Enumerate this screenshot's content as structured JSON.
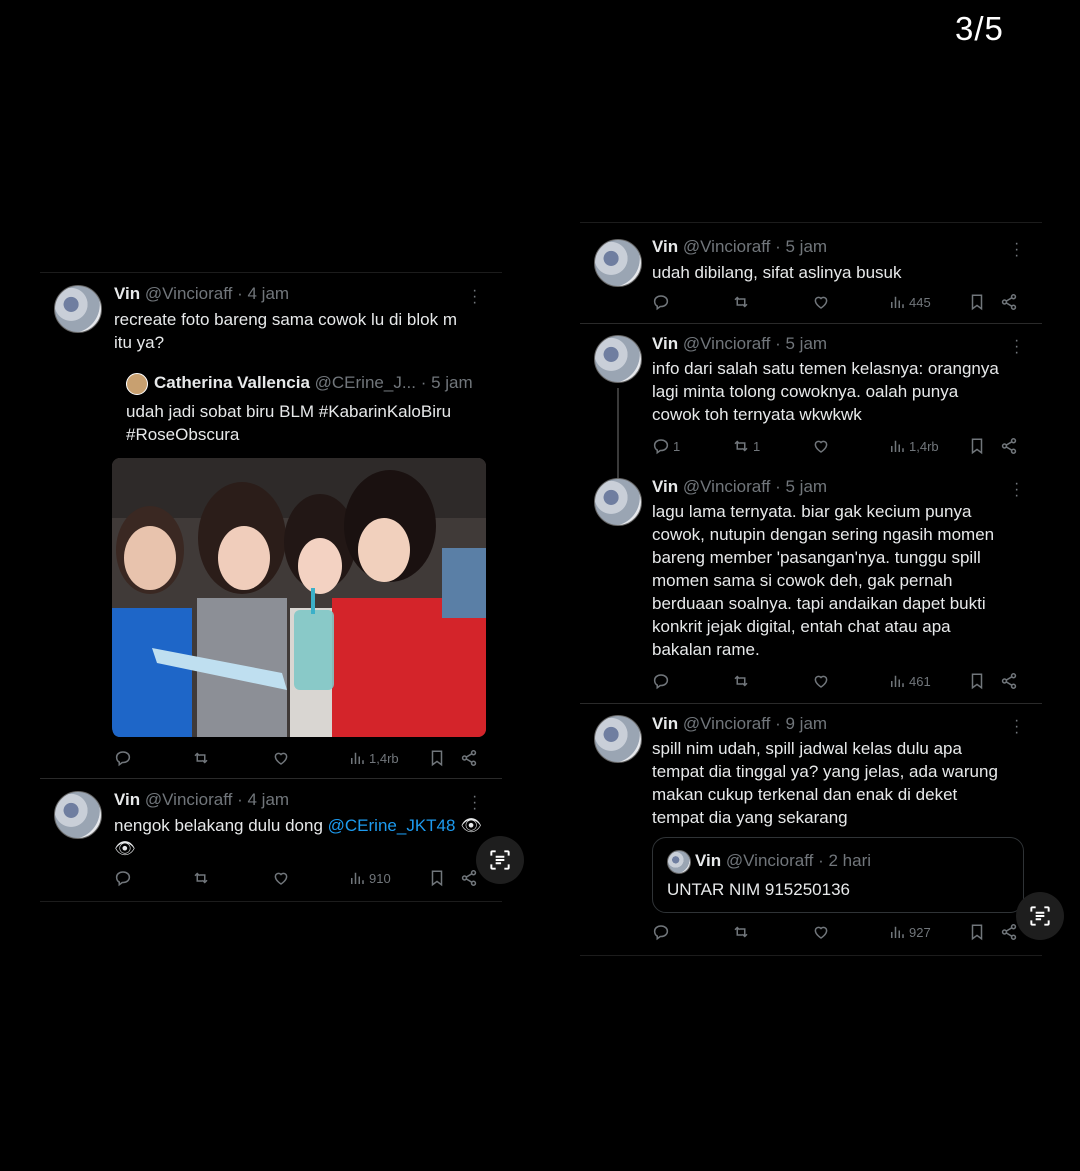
{
  "counter": "3/5",
  "left": {
    "tweets": [
      {
        "name": "Vin",
        "handle_time": "@Vincioraff · 4 jam",
        "text_lines": [
          "recreate foto bareng sama cowok lu di blok m",
          "itu ya?"
        ],
        "quote": {
          "name": "Catherina Vallencia",
          "handle_time": "@CErine_J... · 5 jam",
          "text_lines": [
            "udah jadi sobat biru BLM #KabarinKaloBiru",
            "#RoseObscura"
          ]
        },
        "views": "1,4rb"
      },
      {
        "name": "Vin",
        "handle_time": "@Vincioraff · 4 jam",
        "text_main": "nengok belakang dulu dong ",
        "mention": "@CErine_JKT48",
        "emoji": "👁",
        "views": "910"
      }
    ]
  },
  "right": {
    "tweets": [
      {
        "name": "Vin",
        "handle_time": "@Vincioraff · 5 jam",
        "text_lines": [
          "udah dibilang, sifat aslinya busuk"
        ],
        "views": "445"
      },
      {
        "name": "Vin",
        "handle_time": "@Vincioraff · 5 jam",
        "text_lines": [
          "info dari salah satu temen kelasnya: orangnya",
          "lagi minta tolong cowoknya. oalah punya",
          "cowok toh ternyata wkwkwk"
        ],
        "replies": "1",
        "retweets": "1",
        "views": "1,4rb"
      },
      {
        "name": "Vin",
        "handle_time": "@Vincioraff · 5 jam",
        "text_lines": [
          "lagu lama ternyata. biar gak kecium punya",
          "cowok, nutupin dengan sering ngasih momen",
          "bareng member 'pasangan'nya. tunggu spill",
          "momen sama si cowok deh, gak pernah",
          "berduaan soalnya. tapi andaikan dapet bukti",
          "konkrit jejak digital, entah chat atau apa",
          "bakalan rame."
        ],
        "views": "461"
      },
      {
        "name": "Vin",
        "handle_time": "@Vincioraff · 9 jam",
        "text_lines": [
          "spill nim udah, spill jadwal kelas dulu apa",
          "tempat dia tinggal ya? yang jelas, ada warung",
          "makan cukup terkenal dan enak di deket",
          "tempat dia yang sekarang"
        ],
        "quote": {
          "name": "Vin",
          "handle_time": "@Vincioraff · 2 hari",
          "text": "UNTAR NIM 915250136"
        },
        "views": "927"
      }
    ]
  },
  "colors": {
    "background": "#000000",
    "text": "#e7e9ea",
    "muted": "#71767b",
    "link": "#1d9bf0"
  }
}
